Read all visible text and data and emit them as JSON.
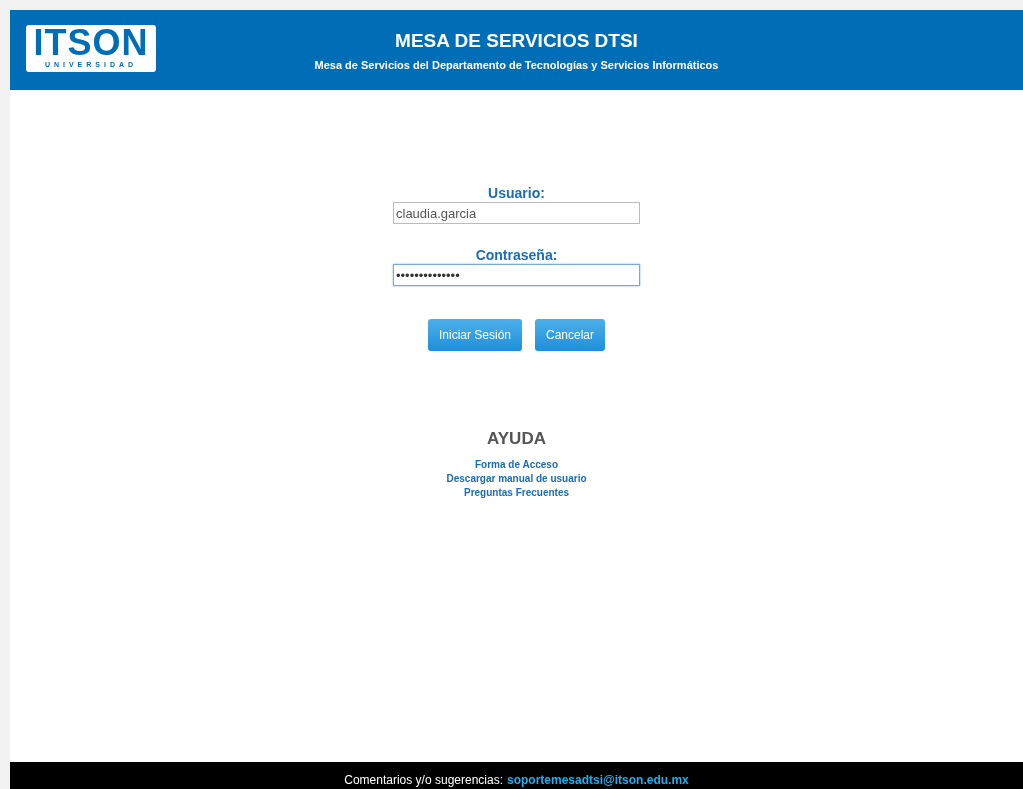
{
  "header": {
    "logo": {
      "name": "ITSON",
      "subtitle": "UNIVERSIDAD"
    },
    "title": "MESA DE SERVICIOS DTSI",
    "subtitle": "Mesa de Servicios del Departamento de Tecnologías y Servicios Informáticos"
  },
  "login": {
    "fields": [
      {
        "label": "Usuario:",
        "value": "claudia.garcia",
        "focused": false
      },
      {
        "label": "Contraseña:",
        "value": "••••••••••••••",
        "focused": true
      }
    ],
    "buttons": [
      "Iniciar Sesión",
      "Cancelar"
    ]
  },
  "help": {
    "title": "AYUDA",
    "links": [
      "Forma de Acceso",
      "Descargar manual de usuario",
      "Preguntas Frecuentes"
    ]
  },
  "footer": {
    "text": "Comentarios y/o sugerencias:",
    "email": "soportemesadtsi@itson.edu.mx"
  }
}
